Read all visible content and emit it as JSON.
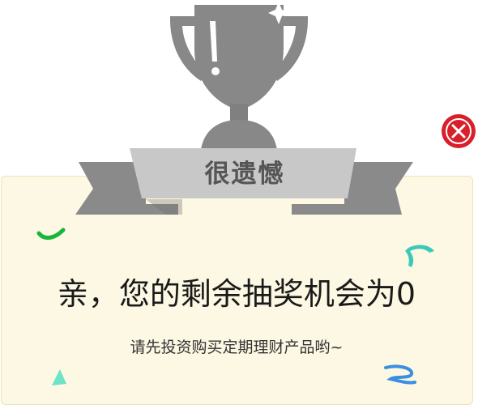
{
  "dialog": {
    "ribbon_title": "很遗憾",
    "message": "亲，您的剩余抽奖机会为0",
    "sub_message": "请先投资购买定期理财产品哟~"
  },
  "icons": {
    "trophy": "trophy-icon",
    "sparkle": "sparkle-icon",
    "close": "close-icon",
    "confetti": "confetti-icon"
  },
  "colors": {
    "trophy": "#888888",
    "trophy_dark": "#6f6f6f",
    "ribbon_front": "#c8c8c8",
    "ribbon_back": "#8a8a8a",
    "card_background": "#fdf8e3",
    "close_button": "#d91f2b",
    "confetti_green": "#16b53c",
    "confetti_teal": "#3cc9b7",
    "confetti_mint": "#6de3c8",
    "confetti_blue": "#3a8fe0"
  }
}
